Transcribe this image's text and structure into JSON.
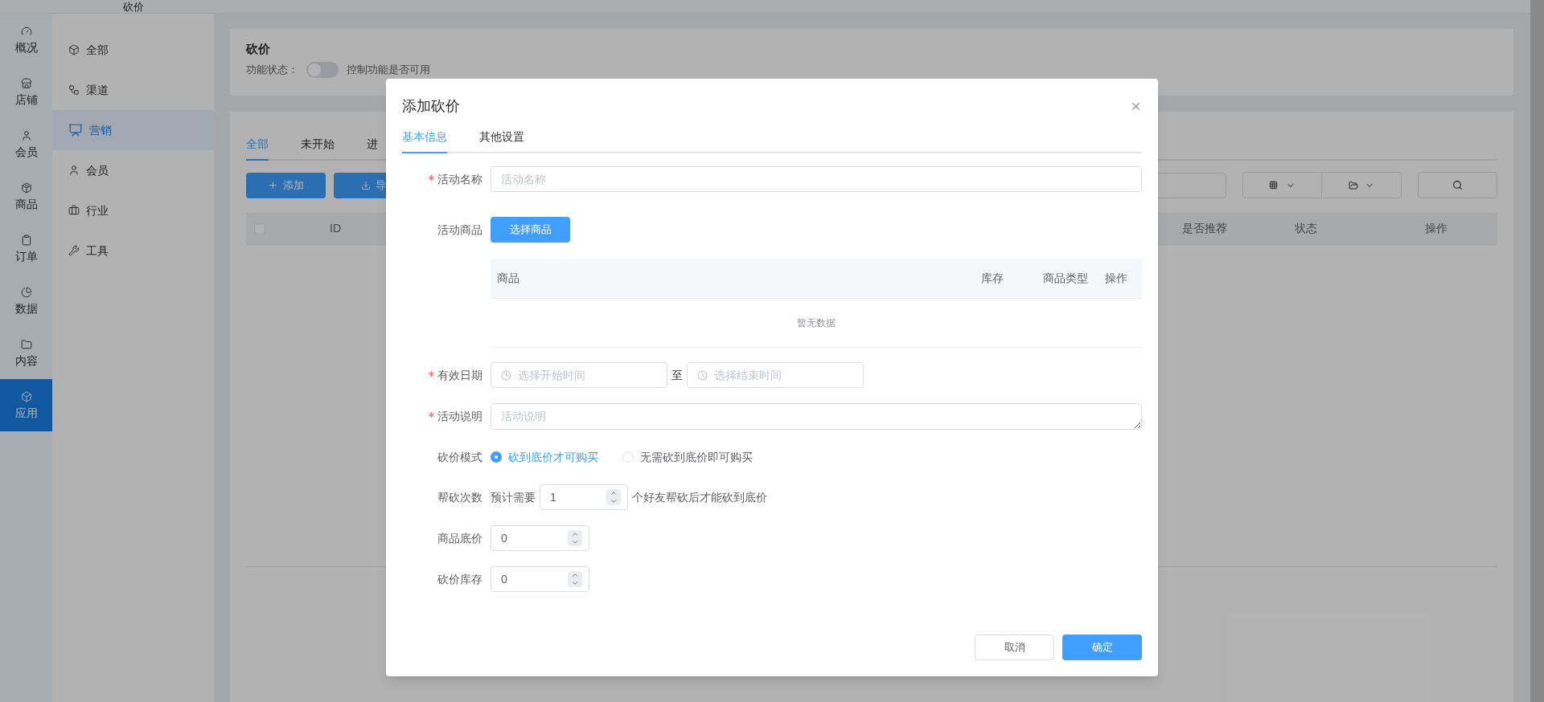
{
  "top_bar": {
    "title": "砍价"
  },
  "nav_rail": [
    {
      "label": "概况",
      "selected": false
    },
    {
      "label": "店铺",
      "selected": false
    },
    {
      "label": "会员",
      "selected": false
    },
    {
      "label": "商品",
      "selected": false
    },
    {
      "label": "订单",
      "selected": false
    },
    {
      "label": "数据",
      "selected": false
    },
    {
      "label": "内容",
      "selected": false
    },
    {
      "label": "应用",
      "selected": true
    }
  ],
  "sub_sidebar": [
    {
      "label": "全部",
      "selected": false
    },
    {
      "label": "渠道",
      "selected": false
    },
    {
      "label": "营销",
      "selected": true
    },
    {
      "label": "会员",
      "selected": false
    },
    {
      "label": "行业",
      "selected": false
    },
    {
      "label": "工具",
      "selected": false
    }
  ],
  "feature_card": {
    "title": "砍价",
    "status_label": "功能状态：",
    "toggle": {
      "on": false
    },
    "hint": "控制功能是否可用"
  },
  "list_tabs": [
    {
      "label": "全部",
      "selected": true
    },
    {
      "label": "未开始",
      "selected": false
    },
    {
      "label": "进",
      "selected": false
    }
  ],
  "list_buttons": [
    {
      "label": "添加"
    },
    {
      "label": "导"
    }
  ],
  "table_checkbox": {
    "checked": false
  },
  "table_columns": [
    "ID",
    "是否推荐",
    "状态",
    "操作"
  ],
  "dialog": {
    "title": "添加砍价",
    "tabs": [
      {
        "label": "基本信息",
        "selected": true
      },
      {
        "label": "其他设置",
        "selected": false
      }
    ],
    "fields": [
      {
        "kind": "text",
        "label": "活动名称",
        "required": true,
        "placeholder": "活动名称"
      },
      {
        "kind": "goods",
        "label": "活动商品",
        "required": false,
        "button": "选择商品",
        "columns": [
          "商品",
          "库存",
          "商品类型",
          "操作"
        ],
        "empty_text": "暂无数据"
      },
      {
        "kind": "daterange",
        "label": "有效日期",
        "required": true,
        "start_placeholder": "选择开始时间",
        "separator": "至",
        "end_placeholder": "选择结束时间"
      },
      {
        "kind": "textarea",
        "label": "活动说明",
        "required": true,
        "placeholder": "活动说明"
      },
      {
        "kind": "radio",
        "label": "砍价模式",
        "required": false,
        "options": [
          {
            "label": "砍到底价才可购买",
            "selected": true
          },
          {
            "label": "无需砍到底价即可购买",
            "selected": false
          }
        ]
      },
      {
        "kind": "sentence",
        "label": "帮砍次数",
        "required": false,
        "prefix": "预计需要",
        "value": "1",
        "suffix": "个好友帮砍后才能砍到底价"
      },
      {
        "kind": "number",
        "label": "商品底价",
        "required": false,
        "value": "0"
      },
      {
        "kind": "number",
        "label": "砍价库存",
        "required": false,
        "value": "0"
      }
    ],
    "buttons": [
      {
        "kind": "default",
        "label": "取消"
      },
      {
        "kind": "primary",
        "label": "确定"
      }
    ]
  }
}
